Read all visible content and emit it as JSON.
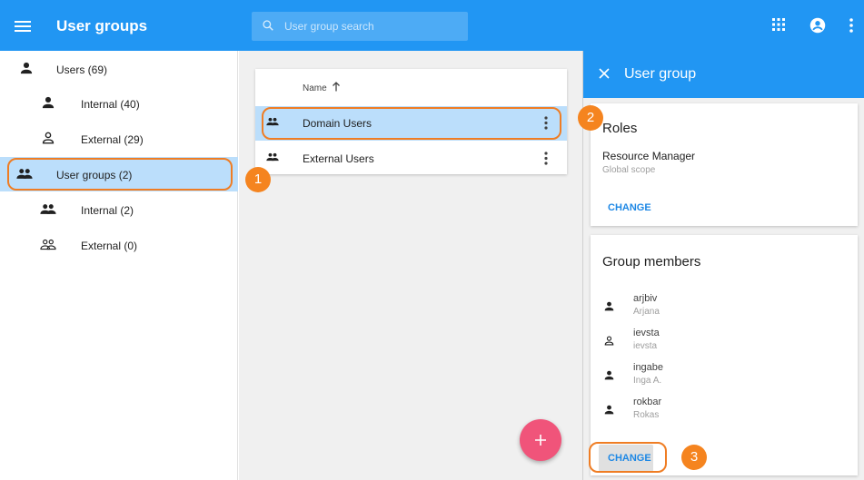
{
  "header": {
    "title": "User groups",
    "menu_icon": "menu-icon",
    "search_placeholder": "User group search",
    "apps_icon": "apps-grid-icon",
    "account_icon": "account-circle-icon",
    "more_icon": "more-vert-icon",
    "bar_color": "#2196f3"
  },
  "sidebar": {
    "items": [
      {
        "label": "Users (69)",
        "icon": "person-icon"
      },
      {
        "label": "Internal (40)",
        "icon": "person-icon"
      },
      {
        "label": "External (29)",
        "icon": "person-outline-icon"
      },
      {
        "label": "User groups (2)",
        "icon": "group-icon",
        "active": true
      },
      {
        "label": "Internal (2)",
        "icon": "group-icon"
      },
      {
        "label": "External (0)",
        "icon": "group-outline-icon"
      }
    ]
  },
  "list": {
    "column_name": "Name",
    "sort": "ascending",
    "rows": [
      {
        "name": "Domain Users",
        "selected": true
      },
      {
        "name": "External Users",
        "selected": false
      }
    ]
  },
  "fab": {
    "label": "+",
    "color": "#f0547a"
  },
  "panel": {
    "title": "User group",
    "roles": {
      "title": "Roles",
      "role_name": "Resource Manager",
      "role_scope": "Global scope",
      "change_label": "CHANGE"
    },
    "members": {
      "title": "Group members",
      "items": [
        {
          "username": "arjbiv",
          "display": "Arjana",
          "icon": "person-icon"
        },
        {
          "username": "ievsta",
          "display": "ievsta",
          "icon": "person-outline-icon"
        },
        {
          "username": "ingabe",
          "display": "Inga A.",
          "icon": "person-icon"
        },
        {
          "username": "rokbar",
          "display": "Rokas",
          "icon": "person-icon"
        }
      ],
      "change_label": "CHANGE"
    }
  },
  "callouts": {
    "one": "1",
    "two": "2",
    "three": "3",
    "color": "#f5841f"
  }
}
